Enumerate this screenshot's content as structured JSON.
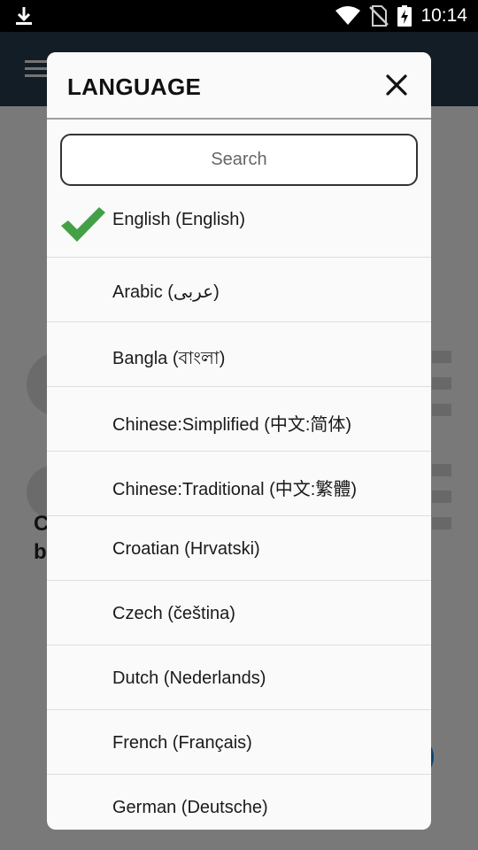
{
  "status_bar": {
    "time": "10:14",
    "icons": [
      "download-icon",
      "wifi-icon",
      "no-sim-icon",
      "battery-charging-icon"
    ]
  },
  "background": {
    "text_line1": "C",
    "text_line2": "b"
  },
  "dialog": {
    "title": "LANGUAGE",
    "close_icon": "close-icon",
    "search_placeholder": "Search",
    "selected_index": 0,
    "languages": [
      {
        "label": "English (English)",
        "selected": true
      },
      {
        "label": "Arabic (عربى)",
        "selected": false
      },
      {
        "label": "Bangla (বাংলা)",
        "selected": false
      },
      {
        "label": "Chinese:Simplified (中文:简体)",
        "selected": false
      },
      {
        "label": "Chinese:Traditional (中文:繁體)",
        "selected": false
      },
      {
        "label": "Croatian (Hrvatski)",
        "selected": false
      },
      {
        "label": "Czech (čeština)",
        "selected": false
      },
      {
        "label": "Dutch (Nederlands)",
        "selected": false
      },
      {
        "label": "French (Français)",
        "selected": false
      },
      {
        "label": "German (Deutsche)",
        "selected": false
      }
    ]
  },
  "colors": {
    "check_green": "#43a047",
    "toolbar": "#263a4b",
    "scrim": "rgba(0,0,0,0.5)"
  }
}
